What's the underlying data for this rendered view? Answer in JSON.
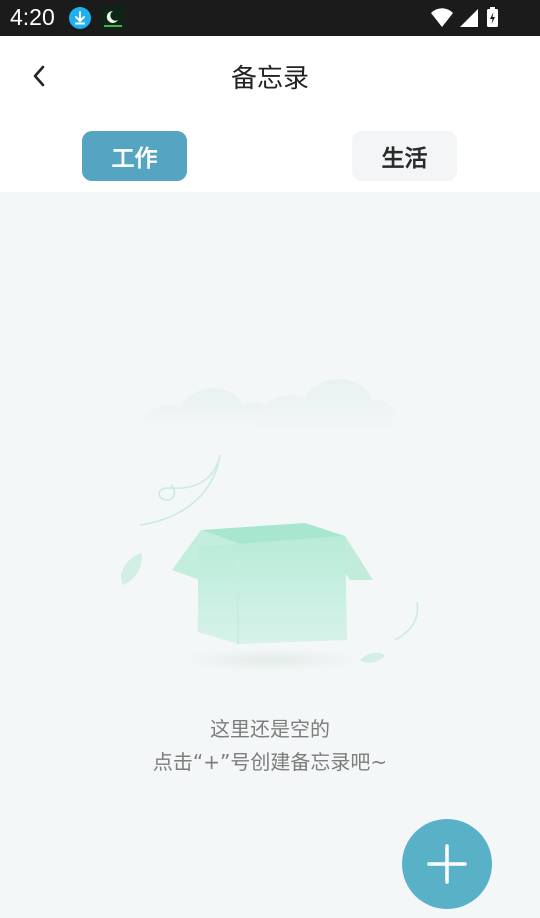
{
  "status_bar": {
    "time": "4:20",
    "icons": [
      "download-icon",
      "app-notification-icon",
      "wifi-icon",
      "cell-signal-icon",
      "battery-icon"
    ]
  },
  "header": {
    "title": "备忘录",
    "back_icon": "chevron-left-icon"
  },
  "tabs": [
    {
      "label": "工作",
      "selected": true
    },
    {
      "label": "生活",
      "selected": false
    }
  ],
  "empty_state": {
    "line1": "这里还是空的",
    "line2": "点击“+”号创建备忘录吧~",
    "illustration": "open-box-icon"
  },
  "fab": {
    "icon": "plus-icon"
  },
  "colors": {
    "accent": "#54a4c2",
    "fab": "#58b1c7",
    "background": "#f4f7f8",
    "status_bar": "#1b1b1b"
  }
}
